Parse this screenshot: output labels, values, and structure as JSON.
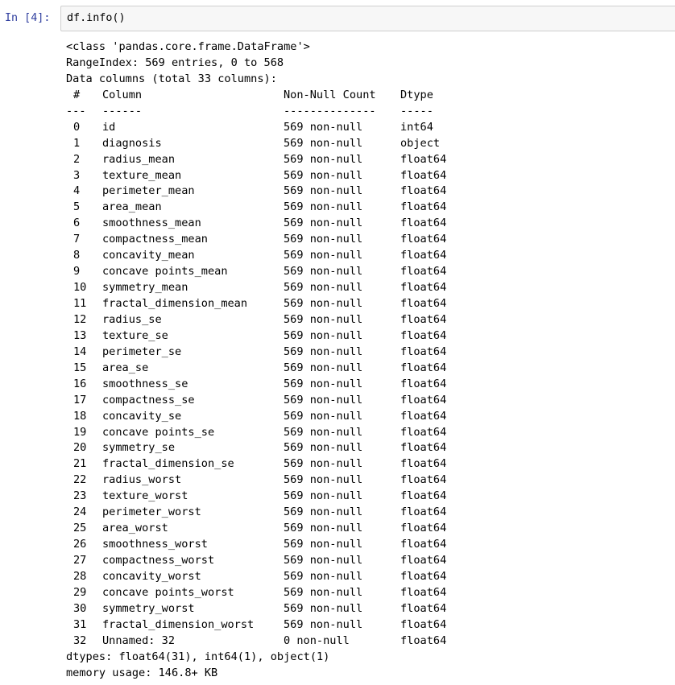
{
  "cell": {
    "prompt": "In [4]:",
    "code": "df.info()"
  },
  "output": {
    "class_line": "<class 'pandas.core.frame.DataFrame'>",
    "range_index": "RangeIndex: 569 entries, 0 to 568",
    "data_columns": "Data columns (total 33 columns):",
    "headers": {
      "num": "#",
      "column": "Column",
      "non_null": "Non-Null Count",
      "dtype": "Dtype"
    },
    "separators": {
      "num": "---",
      "column": "------",
      "non_null": "--------------",
      "dtype": "-----"
    },
    "rows": [
      {
        "num": "0",
        "column": "id",
        "non_null": "569 non-null",
        "dtype": "int64"
      },
      {
        "num": "1",
        "column": "diagnosis",
        "non_null": "569 non-null",
        "dtype": "object"
      },
      {
        "num": "2",
        "column": "radius_mean",
        "non_null": "569 non-null",
        "dtype": "float64"
      },
      {
        "num": "3",
        "column": "texture_mean",
        "non_null": "569 non-null",
        "dtype": "float64"
      },
      {
        "num": "4",
        "column": "perimeter_mean",
        "non_null": "569 non-null",
        "dtype": "float64"
      },
      {
        "num": "5",
        "column": "area_mean",
        "non_null": "569 non-null",
        "dtype": "float64"
      },
      {
        "num": "6",
        "column": "smoothness_mean",
        "non_null": "569 non-null",
        "dtype": "float64"
      },
      {
        "num": "7",
        "column": "compactness_mean",
        "non_null": "569 non-null",
        "dtype": "float64"
      },
      {
        "num": "8",
        "column": "concavity_mean",
        "non_null": "569 non-null",
        "dtype": "float64"
      },
      {
        "num": "9",
        "column": "concave points_mean",
        "non_null": "569 non-null",
        "dtype": "float64"
      },
      {
        "num": "10",
        "column": "symmetry_mean",
        "non_null": "569 non-null",
        "dtype": "float64"
      },
      {
        "num": "11",
        "column": "fractal_dimension_mean",
        "non_null": "569 non-null",
        "dtype": "float64"
      },
      {
        "num": "12",
        "column": "radius_se",
        "non_null": "569 non-null",
        "dtype": "float64"
      },
      {
        "num": "13",
        "column": "texture_se",
        "non_null": "569 non-null",
        "dtype": "float64"
      },
      {
        "num": "14",
        "column": "perimeter_se",
        "non_null": "569 non-null",
        "dtype": "float64"
      },
      {
        "num": "15",
        "column": "area_se",
        "non_null": "569 non-null",
        "dtype": "float64"
      },
      {
        "num": "16",
        "column": "smoothness_se",
        "non_null": "569 non-null",
        "dtype": "float64"
      },
      {
        "num": "17",
        "column": "compactness_se",
        "non_null": "569 non-null",
        "dtype": "float64"
      },
      {
        "num": "18",
        "column": "concavity_se",
        "non_null": "569 non-null",
        "dtype": "float64"
      },
      {
        "num": "19",
        "column": "concave points_se",
        "non_null": "569 non-null",
        "dtype": "float64"
      },
      {
        "num": "20",
        "column": "symmetry_se",
        "non_null": "569 non-null",
        "dtype": "float64"
      },
      {
        "num": "21",
        "column": "fractal_dimension_se",
        "non_null": "569 non-null",
        "dtype": "float64"
      },
      {
        "num": "22",
        "column": "radius_worst",
        "non_null": "569 non-null",
        "dtype": "float64"
      },
      {
        "num": "23",
        "column": "texture_worst",
        "non_null": "569 non-null",
        "dtype": "float64"
      },
      {
        "num": "24",
        "column": "perimeter_worst",
        "non_null": "569 non-null",
        "dtype": "float64"
      },
      {
        "num": "25",
        "column": "area_worst",
        "non_null": "569 non-null",
        "dtype": "float64"
      },
      {
        "num": "26",
        "column": "smoothness_worst",
        "non_null": "569 non-null",
        "dtype": "float64"
      },
      {
        "num": "27",
        "column": "compactness_worst",
        "non_null": "569 non-null",
        "dtype": "float64"
      },
      {
        "num": "28",
        "column": "concavity_worst",
        "non_null": "569 non-null",
        "dtype": "float64"
      },
      {
        "num": "29",
        "column": "concave points_worst",
        "non_null": "569 non-null",
        "dtype": "float64"
      },
      {
        "num": "30",
        "column": "symmetry_worst",
        "non_null": "569 non-null",
        "dtype": "float64"
      },
      {
        "num": "31",
        "column": "fractal_dimension_worst",
        "non_null": "569 non-null",
        "dtype": "float64"
      },
      {
        "num": "32",
        "column": "Unnamed: 32",
        "non_null": "0 non-null",
        "dtype": "float64"
      }
    ],
    "dtypes_line": "dtypes: float64(31), int64(1), object(1)",
    "memory_line": "memory usage: 146.8+ KB"
  },
  "colors": {
    "prompt": "#303f9f",
    "input_bg": "#f7f7f7",
    "input_border": "#cfcfcf"
  }
}
